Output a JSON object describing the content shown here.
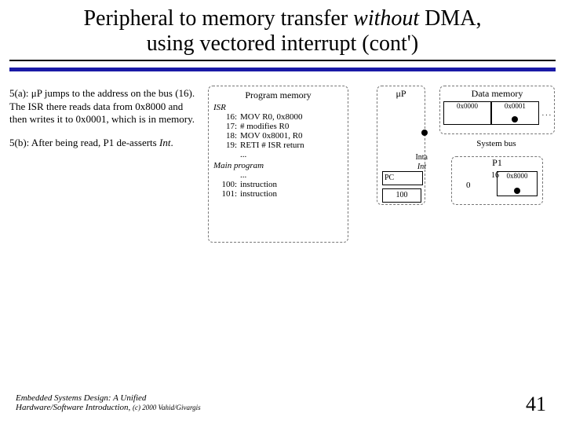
{
  "title": {
    "line1a": "Peripheral to memory transfer ",
    "line1b": "without",
    "line1c": " DMA,",
    "line2": "using vectored interrupt (cont')"
  },
  "left": {
    "p1a": "5(a): μP jumps to the address on the bus (16). The ISR there reads data from 0x8000 and then writes it to 0x0001, which is in memory.",
    "p2a": "5(b): After being read, P1 de-asserts ",
    "p2b": "Int",
    "p2c": "."
  },
  "progmem": {
    "header": "Program memory",
    "isr": "ISR",
    "l16": "16:",
    "i16": "MOV R0, 0x8000",
    "l17": "17:",
    "i17": "# modifies R0",
    "l18": "18:",
    "i18": "MOV 0x8001, R0",
    "l19": "19:",
    "i19": "RETI  # ISR return",
    "dots1": "...",
    "main": "Main program",
    "dots2": "...",
    "l100": "100:",
    "i100": "instruction",
    "l101": "101:",
    "i101": "instruction"
  },
  "up": {
    "label": "μP",
    "pc": "PC",
    "pcval": "100",
    "inta": "Inta",
    "int": "Int"
  },
  "datamem": {
    "header": "Data memory",
    "addr0": "0x0000",
    "addr1": "0x0001",
    "ell": ". . ."
  },
  "sysbus": "System bus",
  "p1": {
    "label": "P1",
    "sixteen": "16",
    "addr": "0x8000",
    "zero": "0"
  },
  "footer": {
    "line1": "Embedded Systems Design: A Unified",
    "line2a": "Hardware/Software Introduction, ",
    "line2b": "(c) 2000 Vahid/Givargis"
  },
  "page": "41"
}
